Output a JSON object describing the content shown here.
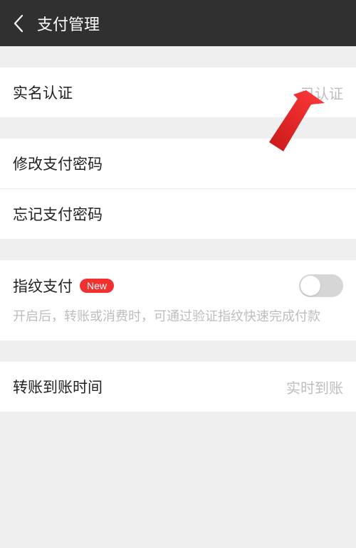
{
  "header": {
    "title": "支付管理"
  },
  "rows": {
    "realname": {
      "label": "实名认证",
      "value": "已认证"
    },
    "modify_pw": {
      "label": "修改支付密码"
    },
    "forgot_pw": {
      "label": "忘记支付密码"
    },
    "fingerprint": {
      "label": "指纹支付",
      "badge": "New",
      "hint": "开启后，转账或消费时，可通过验证指纹快速完成付款"
    },
    "transfer_time": {
      "label": "转账到账时间",
      "value": "实时到账"
    }
  },
  "colors": {
    "accent": "#f23030"
  }
}
